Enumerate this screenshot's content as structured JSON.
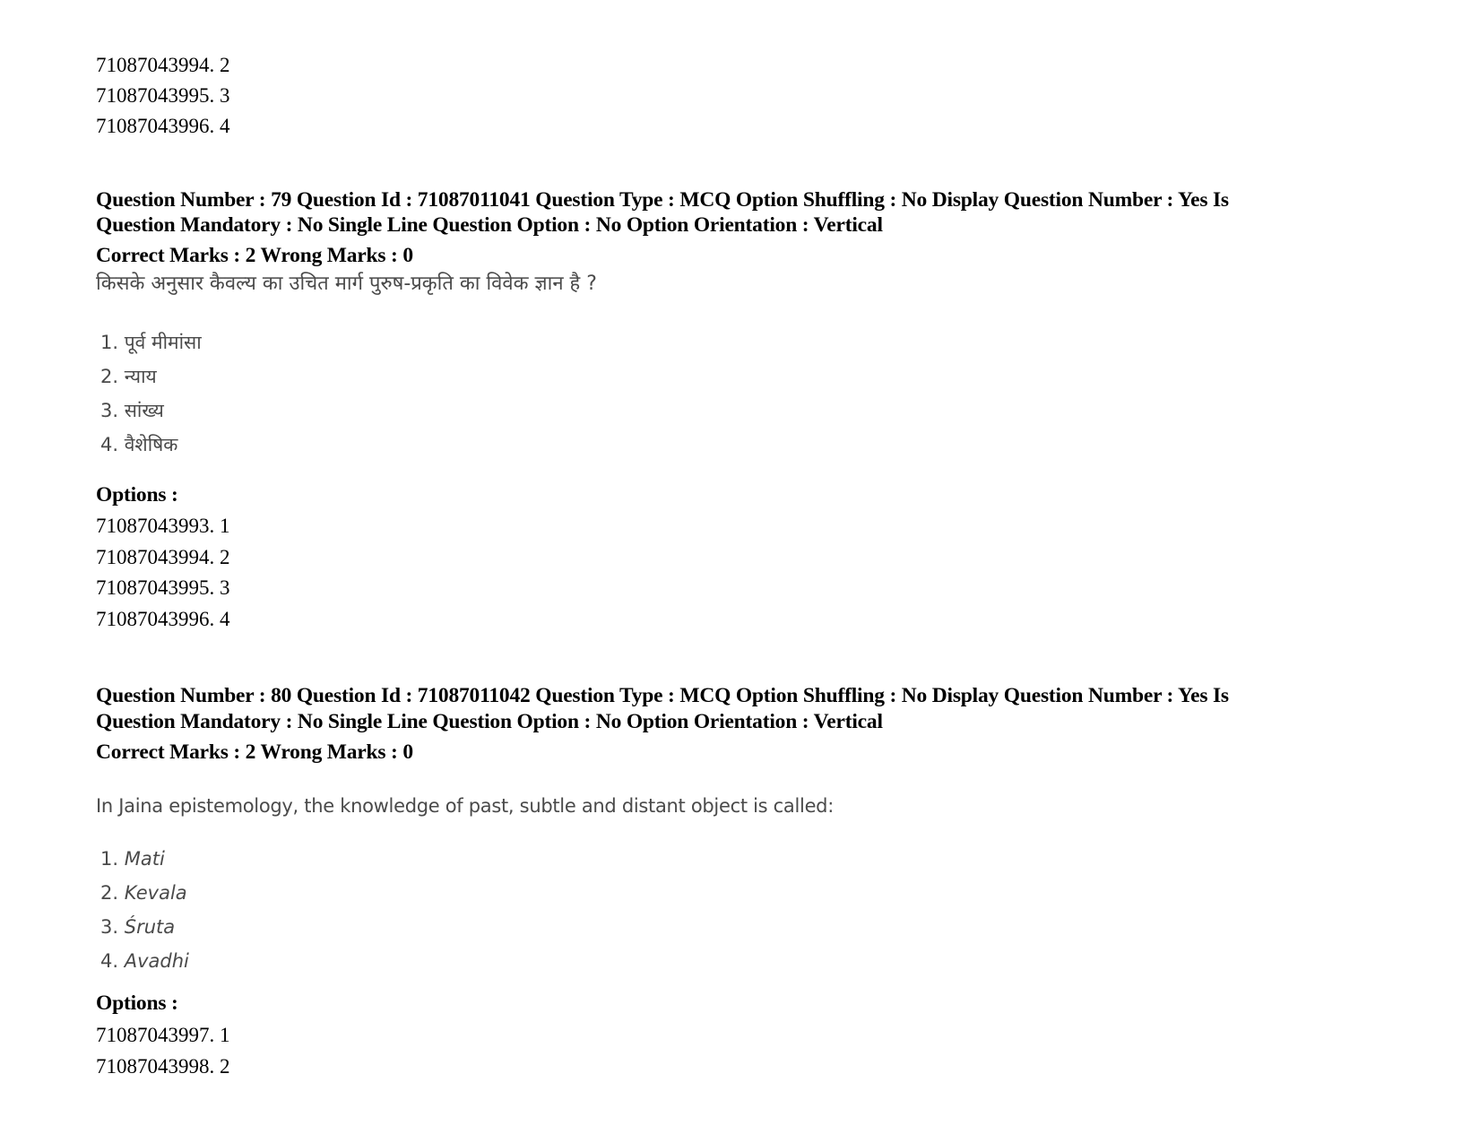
{
  "top_options": [
    {
      "id": "71087043994",
      "value": "2"
    },
    {
      "id": "71087043995",
      "value": "3"
    },
    {
      "id": "71087043996",
      "value": "4"
    }
  ],
  "questions": [
    {
      "header_line1": "Question Number : 79 Question Id : 71087011041 Question Type : MCQ Option Shuffling : No Display Question Number : Yes Is",
      "header_line2": "Question Mandatory : No Single Line Question Option : No Option Orientation : Vertical",
      "marks": "Correct Marks : 2 Wrong Marks : 0",
      "question_text": "किसके अनुसार कैवल्य का उचित मार्ग पुरुष-प्रकृति का विवेक ज्ञान है ?",
      "choices": [
        {
          "num": "1.",
          "text": "पूर्व मीमांसा"
        },
        {
          "num": "2.",
          "text": "न्याय"
        },
        {
          "num": "3.",
          "text": "सांख्य"
        },
        {
          "num": "4.",
          "text": "वैशेषिक"
        }
      ],
      "options_label": "Options :",
      "options": [
        {
          "id": "71087043993",
          "value": "1"
        },
        {
          "id": "71087043994",
          "value": "2"
        },
        {
          "id": "71087043995",
          "value": "3"
        },
        {
          "id": "71087043996",
          "value": "4"
        }
      ]
    },
    {
      "header_line1": "Question Number : 80 Question Id : 71087011042 Question Type : MCQ Option Shuffling : No Display Question Number : Yes Is",
      "header_line2": "Question Mandatory : No Single Line Question Option : No Option Orientation : Vertical",
      "marks": "Correct Marks : 2 Wrong Marks : 0",
      "question_text": "In Jaina epistemology, the knowledge of past, subtle and distant object is called:",
      "choices": [
        {
          "num": "1.",
          "text": "Mati"
        },
        {
          "num": "2.",
          "text": "Kevala"
        },
        {
          "num": "3.",
          "text": "Śruta"
        },
        {
          "num": "4.",
          "text": "Avadhi"
        }
      ],
      "options_label": "Options :",
      "options": [
        {
          "id": "71087043997",
          "value": "1"
        },
        {
          "id": "71087043998",
          "value": "2"
        }
      ]
    }
  ]
}
